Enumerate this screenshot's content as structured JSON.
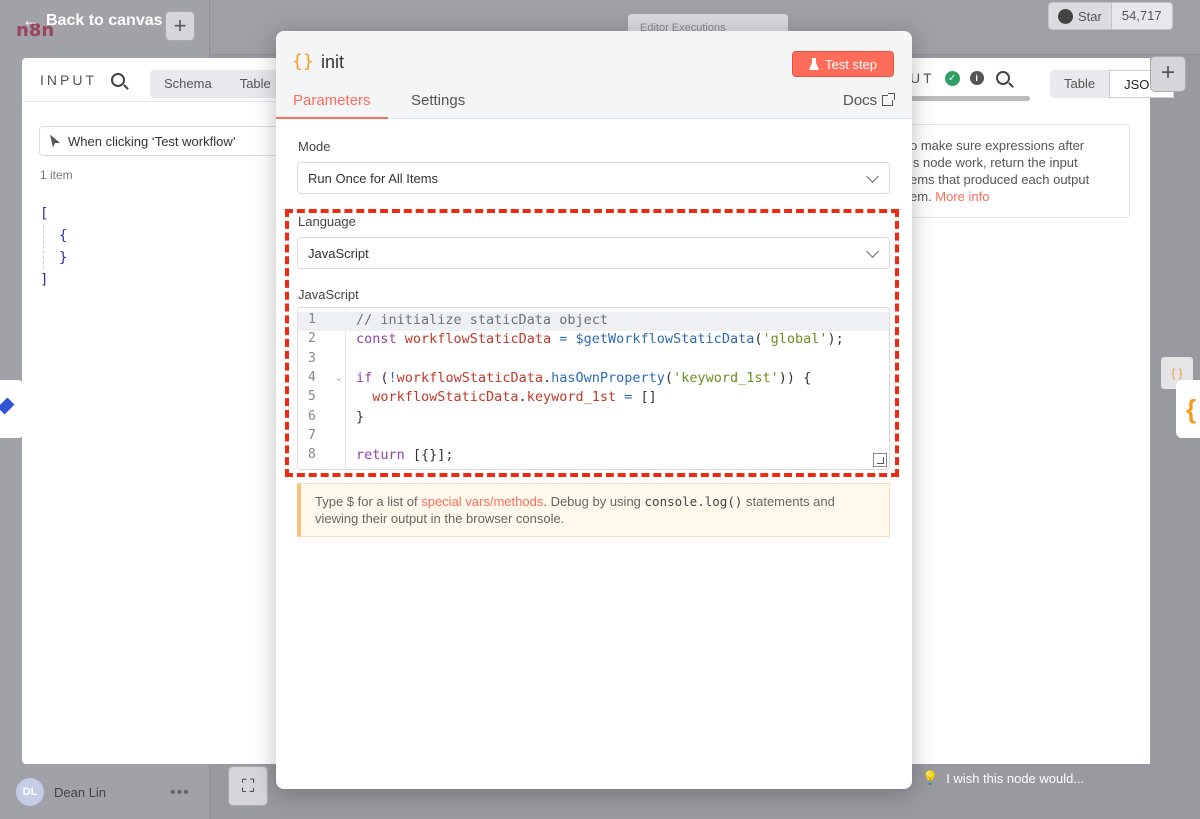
{
  "app": {
    "logo_text": "n8n",
    "back_label": "Back to canvas",
    "add_symbol": "+",
    "editor_tabs": "Editor  Executions",
    "github": {
      "star_label": "Star",
      "star_count": "54,717",
      "icon": "github-icon"
    },
    "user": {
      "initials": "DL",
      "name": "Dean Lin",
      "more": "•••"
    },
    "wish_text": "I wish this node would..."
  },
  "input_panel": {
    "title": "INPUT",
    "view_tabs": [
      "Schema",
      "Table"
    ],
    "trigger_select": "When clicking ‘Test workflow’",
    "item_count": "1 item",
    "json_lines": [
      "[",
      "{",
      "}",
      "]"
    ]
  },
  "output_panel": {
    "title": "UT",
    "view_tabs": [
      "Table",
      "JSON"
    ],
    "note_text": "o make sure expressions after\nis node work, return the input\nems that produced each output\nem.",
    "note_link": "More info"
  },
  "modal": {
    "node_icon": "{}",
    "node_name": "init",
    "test_button": "Test step",
    "tabs": [
      "Parameters",
      "Settings"
    ],
    "active_tab": "Parameters",
    "docs_label": "Docs",
    "mode_label": "Mode",
    "mode_value": "Run Once for All Items",
    "language_label": "Language",
    "language_value": "JavaScript",
    "code_label": "JavaScript",
    "code_lines": [
      "// initialize staticData object",
      "const workflowStaticData = $getWorkflowStaticData('global');",
      "",
      "if (!workflowStaticData.hasOwnProperty('keyword_1st')) {",
      "  workflowStaticData.keyword_1st = []",
      "}",
      "",
      "return [{}];"
    ],
    "hint": {
      "part1": "Type $ for a list of ",
      "link": "special vars/methods",
      "part2": ". Debug by using ",
      "code": "console.log()",
      "part3": " statements and viewing their output in the browser console."
    }
  },
  "colors": {
    "accent": "#ff6d5a",
    "highlight_dash": "#ee2a12",
    "node_icon": "#f59b1b",
    "success": "#2f9e63"
  }
}
